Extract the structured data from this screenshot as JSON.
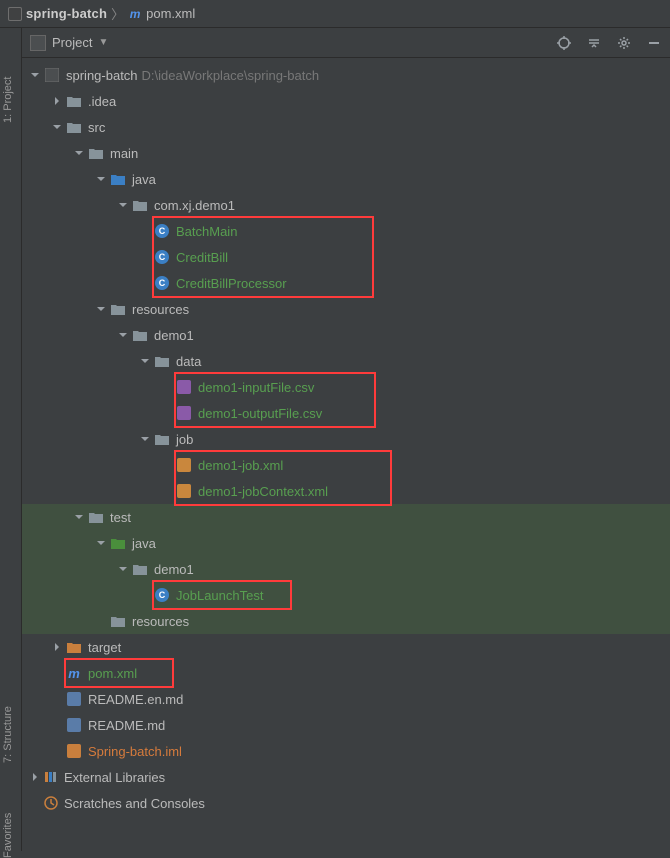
{
  "breadcrumb": {
    "project": "spring-batch",
    "file": "pom.xml"
  },
  "panel": {
    "title": "Project"
  },
  "sidebar": {
    "project": "1: Project",
    "structure": "7: Structure",
    "favorites": "Favorites"
  },
  "tree": {
    "root": "spring-batch",
    "rootPath": "D:\\ideaWorkplace\\spring-batch",
    "idea": ".idea",
    "src": "src",
    "main": "main",
    "java": "java",
    "package": "com.xj.demo1",
    "batchMain": "BatchMain",
    "creditBill": "CreditBill",
    "creditBillProcessor": "CreditBillProcessor",
    "resources": "resources",
    "demo1": "demo1",
    "data": "data",
    "inputFile": "demo1-inputFile.csv",
    "outputFile": "demo1-outputFile.csv",
    "job": "job",
    "jobXml": "demo1-job.xml",
    "jobContextXml": "demo1-jobContext.xml",
    "test": "test",
    "testJava": "java",
    "testDemo1": "demo1",
    "jobLaunchTest": "JobLaunchTest",
    "testResources": "resources",
    "target": "target",
    "pomXml": "pom.xml",
    "readmeEn": "README.en.md",
    "readme": "README.md",
    "iml": "Spring-batch.iml",
    "externalLibs": "External Libraries",
    "scratches": "Scratches and Consoles"
  }
}
